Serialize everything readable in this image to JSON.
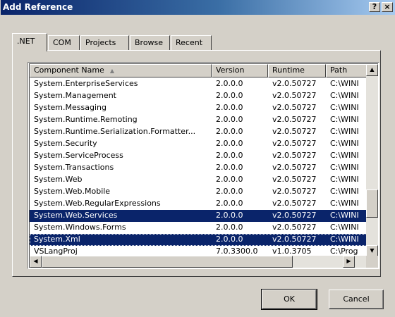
{
  "window": {
    "title": "Add Reference",
    "help_label": "?",
    "close_label": "×"
  },
  "tabs": [
    {
      "label": ".NET",
      "active": true
    },
    {
      "label": "COM"
    },
    {
      "label": "Projects"
    },
    {
      "label": "Browse"
    },
    {
      "label": "Recent"
    }
  ],
  "list": {
    "columns": [
      "Component Name",
      "Version",
      "Runtime",
      "Path"
    ],
    "sort_icon": "sort-ascending-icon",
    "rows": [
      {
        "name": "System.EnterpriseServices",
        "version": "2.0.0.0",
        "runtime": "v2.0.50727",
        "path": "C:\\WINI"
      },
      {
        "name": "System.Management",
        "version": "2.0.0.0",
        "runtime": "v2.0.50727",
        "path": "C:\\WINI"
      },
      {
        "name": "System.Messaging",
        "version": "2.0.0.0",
        "runtime": "v2.0.50727",
        "path": "C:\\WINI"
      },
      {
        "name": "System.Runtime.Remoting",
        "version": "2.0.0.0",
        "runtime": "v2.0.50727",
        "path": "C:\\WINI"
      },
      {
        "name": "System.Runtime.Serialization.Formatter...",
        "version": "2.0.0.0",
        "runtime": "v2.0.50727",
        "path": "C:\\WINI"
      },
      {
        "name": "System.Security",
        "version": "2.0.0.0",
        "runtime": "v2.0.50727",
        "path": "C:\\WINI"
      },
      {
        "name": "System.ServiceProcess",
        "version": "2.0.0.0",
        "runtime": "v2.0.50727",
        "path": "C:\\WINI"
      },
      {
        "name": "System.Transactions",
        "version": "2.0.0.0",
        "runtime": "v2.0.50727",
        "path": "C:\\WINI"
      },
      {
        "name": "System.Web",
        "version": "2.0.0.0",
        "runtime": "v2.0.50727",
        "path": "C:\\WINI"
      },
      {
        "name": "System.Web.Mobile",
        "version": "2.0.0.0",
        "runtime": "v2.0.50727",
        "path": "C:\\WINI"
      },
      {
        "name": "System.Web.RegularExpressions",
        "version": "2.0.0.0",
        "runtime": "v2.0.50727",
        "path": "C:\\WINI"
      },
      {
        "name": "System.Web.Services",
        "version": "2.0.0.0",
        "runtime": "v2.0.50727",
        "path": "C:\\WINI",
        "selected": true
      },
      {
        "name": "System.Windows.Forms",
        "version": "2.0.0.0",
        "runtime": "v2.0.50727",
        "path": "C:\\WINI"
      },
      {
        "name": "System.Xml",
        "version": "2.0.0.0",
        "runtime": "v2.0.50727",
        "path": "C:\\WINI",
        "selected": true,
        "focused": true
      },
      {
        "name": "VSLangProj",
        "version": "7.0.3300.0",
        "runtime": "v1.0.3705",
        "path": "C:\\Prog"
      }
    ]
  },
  "buttons": {
    "ok": "OK",
    "cancel": "Cancel"
  },
  "colors": {
    "selection": "#0a246a",
    "face": "#d4d0c8",
    "title_start": "#0a246a",
    "title_end": "#a6caf0"
  }
}
